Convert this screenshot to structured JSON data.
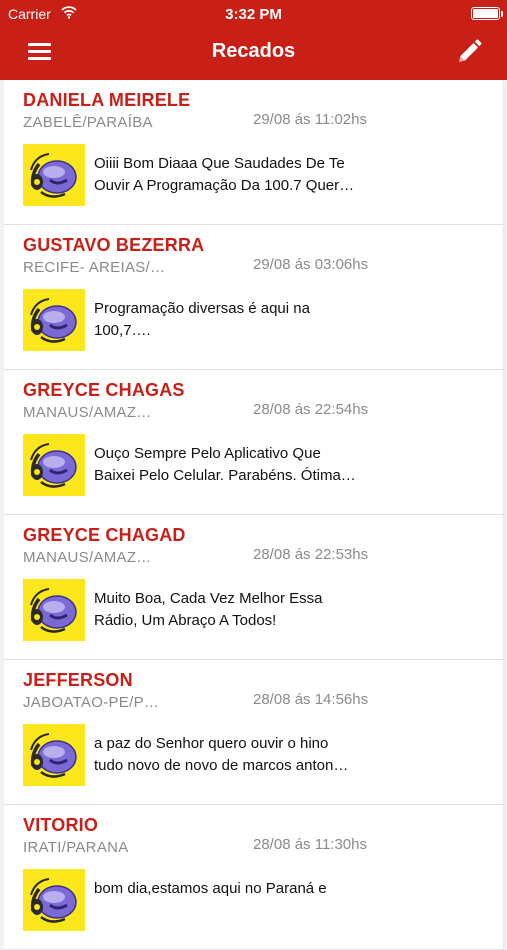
{
  "status_bar": {
    "carrier": "Carrier",
    "time": "3:32 PM"
  },
  "nav": {
    "title": "Recados",
    "menu_icon": "menu-icon",
    "edit_icon": "pencil-icon"
  },
  "colors": {
    "brand": "#c81f17",
    "avatar_bg": "#fce71d",
    "avatar_logo": "#7b6ad6"
  },
  "messages": [
    {
      "name": "DANIELA MEIRELE",
      "city": "ZABELÊ/PARAÍBA",
      "date": "29/08 ás 11:02hs",
      "text": "Oiiii Bom Diaaa Que Saudades De Te\nOuvir A Programação Da 100.7 Quer…"
    },
    {
      "name": "GUSTAVO BEZERRA",
      "city": "RECIFE- AREIAS/…",
      "date": "29/08 ás 03:06hs",
      "text": "Programação diversas é aqui na\n100,7…."
    },
    {
      "name": "GREYCE CHAGAS",
      "city": "MANAUS/AMAZ…",
      "date": "28/08 ás 22:54hs",
      "text": "Ouço Sempre Pelo Aplicativo Que\nBaixei Pelo Celular. Parabéns. Ótima…"
    },
    {
      "name": "GREYCE CHAGAD",
      "city": "MANAUS/AMAZ…",
      "date": "28/08 ás 22:53hs",
      "text": "Muito Boa, Cada Vez Melhor Essa\nRádio, Um Abraço A Todos!"
    },
    {
      "name": "JEFFERSON",
      "city": "JABOATAO-PE/P…",
      "date": "28/08 ás 14:56hs",
      "text": "a paz do Senhor quero ouvir o hino\ntudo novo de novo de marcos anton…"
    },
    {
      "name": "VITORIO",
      "city": "IRATI/PARANA",
      "date": "28/08 ás 11:30hs",
      "text": "bom dia,estamos aqui no Paraná e"
    }
  ]
}
